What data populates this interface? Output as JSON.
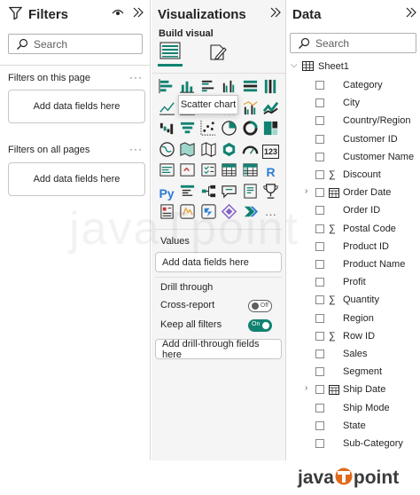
{
  "filters": {
    "title": "Filters",
    "search_placeholder": "Search",
    "on_this_page_label": "Filters on this page",
    "on_all_pages_label": "Filters on all pages",
    "add_fields_label": "Add data fields here"
  },
  "visualizations": {
    "title": "Visualizations",
    "build_visual_label": "Build visual",
    "tooltip": "Scatter chart",
    "values_label": "Values",
    "values_well": "Add data fields here",
    "drill_through_label": "Drill through",
    "cross_report_label": "Cross-report",
    "cross_report_state": "Off",
    "cross_report_value": 0,
    "keep_all_filters_label": "Keep all filters",
    "keep_all_filters_state": "On",
    "keep_all_filters_value": 1,
    "drill_through_well": "Add drill-through fields here",
    "icons": [
      "stacked-bar-chart-icon",
      "stacked-column-chart-icon",
      "clustered-bar-chart-icon",
      "clustered-column-chart-icon",
      "100-stacked-bar-chart-icon",
      "100-stacked-column-chart-icon",
      "line-chart-icon",
      "area-chart-icon",
      "stacked-area-chart-icon",
      "line-and-column-chart-icon",
      "line-and-clustered-column-chart-icon",
      "ribbon-chart-icon",
      "waterfall-chart-icon",
      "funnel-chart-icon",
      "scatter-chart-icon",
      "pie-chart-icon",
      "donut-chart-icon",
      "treemap-icon",
      "map-icon",
      "filled-map-icon",
      "shape-map-icon",
      "azure-map-icon",
      "gauge-icon",
      "card-icon",
      "multi-row-card-icon",
      "kpi-icon",
      "slicer-icon",
      "table-icon",
      "matrix-icon",
      "r-script-visual-icon",
      "python-visual-icon",
      "key-influencers-icon",
      "decomposition-tree-icon",
      "qa-icon",
      "smart-narrative-icon",
      "goals-icon",
      "paginated-report-icon",
      "power-apps-icon",
      "power-automate-icon",
      "get-more-visuals-icon",
      "arrow-visual-icon",
      "more-options-icon"
    ],
    "text_icons": {
      "card": "123",
      "r": "R",
      "py": "Py",
      "more": "···"
    }
  },
  "data": {
    "title": "Data",
    "search_placeholder": "Search",
    "table_name": "Sheet1",
    "fields": [
      {
        "name": "Category",
        "type": "text"
      },
      {
        "name": "City",
        "type": "text"
      },
      {
        "name": "Country/Region",
        "type": "text"
      },
      {
        "name": "Customer ID",
        "type": "text"
      },
      {
        "name": "Customer Name",
        "type": "text"
      },
      {
        "name": "Discount",
        "type": "sum"
      },
      {
        "name": "Order Date",
        "type": "date"
      },
      {
        "name": "Order ID",
        "type": "text"
      },
      {
        "name": "Postal Code",
        "type": "sum"
      },
      {
        "name": "Product ID",
        "type": "text"
      },
      {
        "name": "Product Name",
        "type": "text"
      },
      {
        "name": "Profit",
        "type": "text"
      },
      {
        "name": "Quantity",
        "type": "sum"
      },
      {
        "name": "Region",
        "type": "text"
      },
      {
        "name": "Row ID",
        "type": "sum"
      },
      {
        "name": "Sales",
        "type": "text"
      },
      {
        "name": "Segment",
        "type": "text"
      },
      {
        "name": "Ship Date",
        "type": "date"
      },
      {
        "name": "Ship Mode",
        "type": "text"
      },
      {
        "name": "State",
        "type": "text"
      },
      {
        "name": "Sub-Category",
        "type": "text"
      }
    ]
  },
  "watermark": "javaTpoint",
  "logo": {
    "part1": "java",
    "part2": "point"
  },
  "colors": {
    "accent": "#118271",
    "logo_t": "#e06a1b"
  }
}
